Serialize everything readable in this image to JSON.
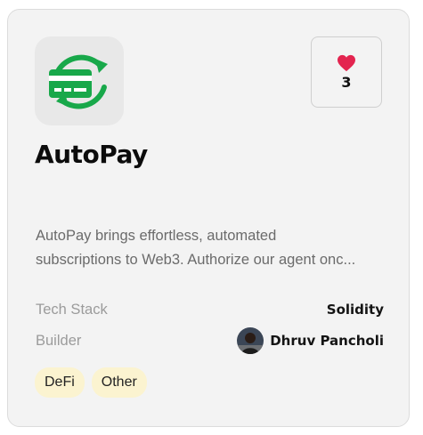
{
  "project": {
    "title": "AutoPay",
    "logo_icon": "card-refresh-icon",
    "description_lines": [
      "AutoPay brings effortless, automated",
      "subscriptions to Web3. Authorize our agent onc..."
    ],
    "likes": {
      "icon": "heart-icon",
      "count": "3",
      "color": "#e3244f"
    },
    "tech_stack": {
      "label": "Tech Stack",
      "value": "Solidity"
    },
    "builder": {
      "label": "Builder",
      "name": "Dhruv Pancholi",
      "avatar_icon": "user-avatar"
    },
    "tags": [
      "DeFi",
      "Other"
    ]
  },
  "colors": {
    "logo_green": "#18a84a",
    "tag_background": "#fbf3d0",
    "card_background": "#f3f3f3"
  }
}
